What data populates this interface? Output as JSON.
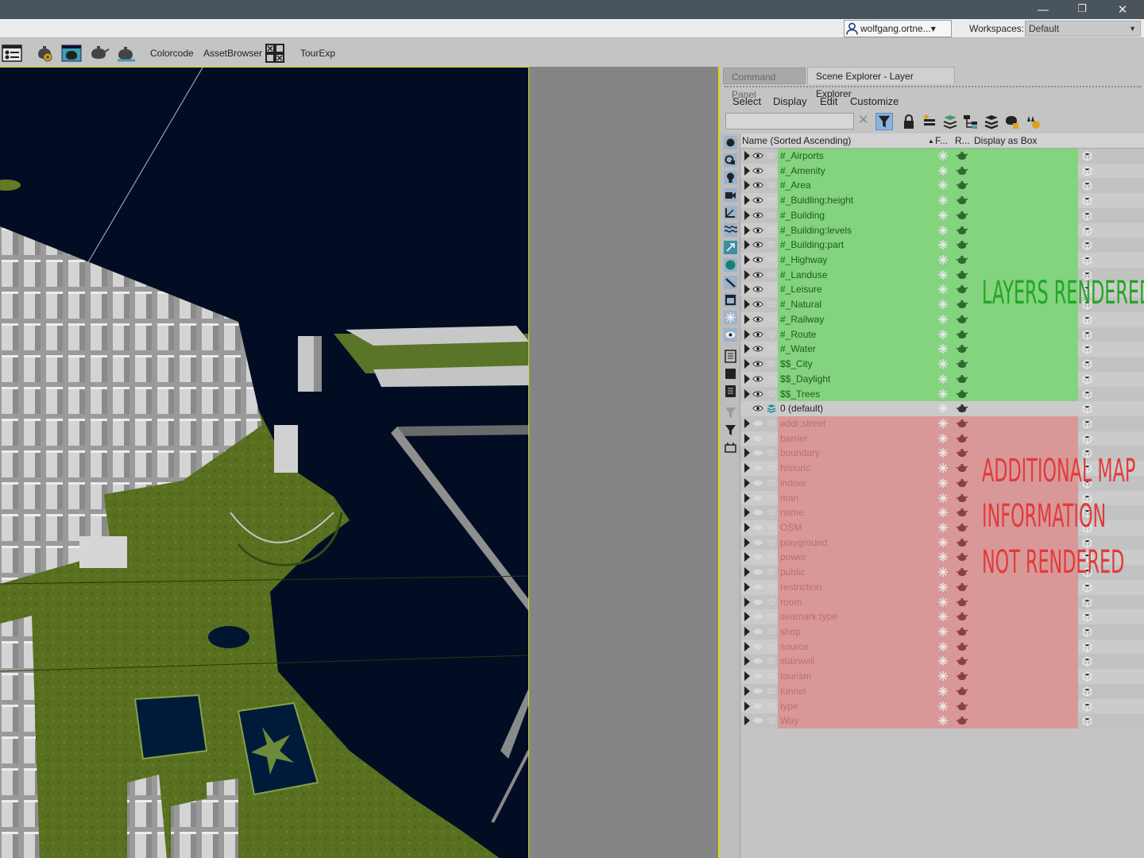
{
  "window": {
    "minimize": "—",
    "restore": "❐",
    "close": "✕"
  },
  "topbar": {
    "user": "wolfgang.ortne...▾",
    "workspaces_label": "Workspaces:",
    "workspaces_value": "Default"
  },
  "toolbar": {
    "colorcode": "Colorcode",
    "assetbrowser": "AssetBrowser",
    "tourexp": "TourExp"
  },
  "panel": {
    "tabs": [
      "Command Panel",
      "Scene Explorer - Layer Explorer"
    ],
    "menu": [
      "Select",
      "Display",
      "Edit",
      "Customize"
    ],
    "search_value": "",
    "columns": {
      "name": "Name (Sorted Ascending)",
      "sort_arrow": "▲",
      "frozen": "F...",
      "renderable": "R...",
      "display_as_box": "Display as Box"
    }
  },
  "colors": {
    "rendered_row": "#83d37f",
    "unrendered_row": "#d89898",
    "rendered_text": "#1b5e1b",
    "unrendered_text": "#bb6e6e",
    "anno_green": "#22a622",
    "anno_red": "#e23a3a",
    "accent_yellow": "#d8d820"
  },
  "layers": [
    {
      "name": "#_Airports",
      "state": "rendered"
    },
    {
      "name": "#_Amenity",
      "state": "rendered"
    },
    {
      "name": "#_Area",
      "state": "rendered"
    },
    {
      "name": "#_Buidling:height",
      "state": "rendered"
    },
    {
      "name": "#_Building",
      "state": "rendered"
    },
    {
      "name": "#_Building:levels",
      "state": "rendered"
    },
    {
      "name": "#_Building:part",
      "state": "rendered"
    },
    {
      "name": "#_Highway",
      "state": "rendered"
    },
    {
      "name": "#_Landuse",
      "state": "rendered"
    },
    {
      "name": "#_Leisure",
      "state": "rendered"
    },
    {
      "name": "#_Natural",
      "state": "rendered"
    },
    {
      "name": "#_Railway",
      "state": "rendered"
    },
    {
      "name": "#_Route",
      "state": "rendered"
    },
    {
      "name": "#_Water",
      "state": "rendered"
    },
    {
      "name": "$$_City",
      "state": "rendered"
    },
    {
      "name": "$$_Daylight",
      "state": "rendered"
    },
    {
      "name": "$$_Trees",
      "state": "rendered"
    },
    {
      "name": "0 (default)",
      "state": "default"
    },
    {
      "name": "addr:street",
      "state": "hidden"
    },
    {
      "name": "barrier",
      "state": "hidden"
    },
    {
      "name": "boundary",
      "state": "hidden"
    },
    {
      "name": "historic",
      "state": "hidden"
    },
    {
      "name": "indoor",
      "state": "hidden"
    },
    {
      "name": "man",
      "state": "hidden"
    },
    {
      "name": "name",
      "state": "hidden"
    },
    {
      "name": "OSM",
      "state": "hidden"
    },
    {
      "name": "playground",
      "state": "hidden"
    },
    {
      "name": "power",
      "state": "hidden"
    },
    {
      "name": "public",
      "state": "hidden"
    },
    {
      "name": "restriction",
      "state": "hidden"
    },
    {
      "name": "room",
      "state": "hidden"
    },
    {
      "name": "seamark:type",
      "state": "hidden"
    },
    {
      "name": "shop",
      "state": "hidden"
    },
    {
      "name": "source",
      "state": "hidden"
    },
    {
      "name": "stairwell",
      "state": "hidden"
    },
    {
      "name": "tourism",
      "state": "hidden"
    },
    {
      "name": "tunnel",
      "state": "hidden"
    },
    {
      "name": "type",
      "state": "hidden"
    },
    {
      "name": "Way",
      "state": "hidden"
    }
  ],
  "annotations": {
    "rendered": "LAYERS RENDERED",
    "not_rendered_1": "ADDITIONAL MAP",
    "not_rendered_2": "INFORMATION",
    "not_rendered_3": "NOT RENDERED"
  }
}
